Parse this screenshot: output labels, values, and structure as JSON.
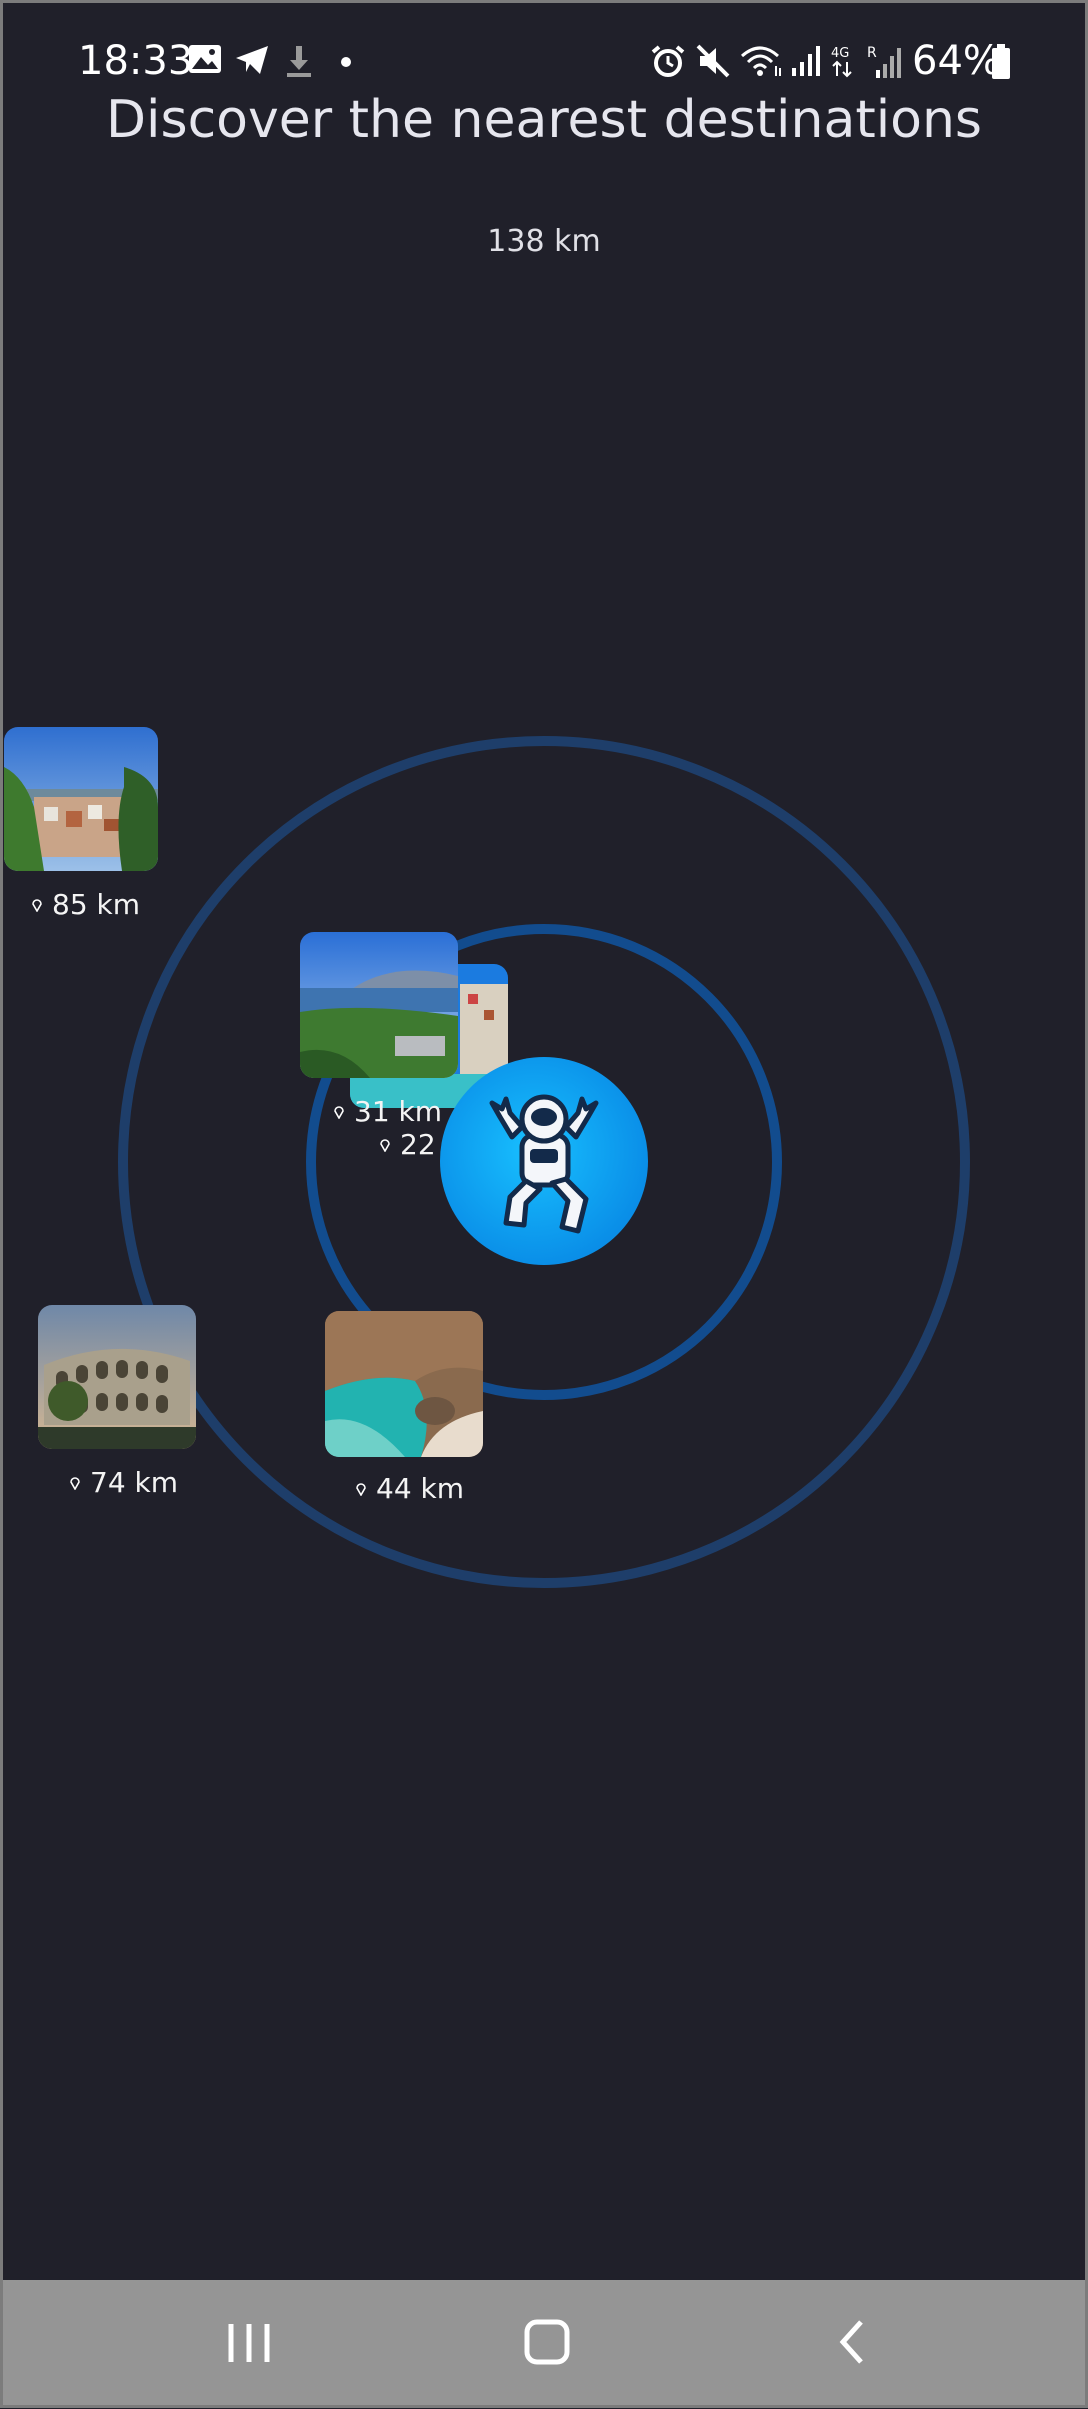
{
  "status_bar": {
    "time": "18:33",
    "battery_percent": "64%",
    "icons": [
      "image-icon",
      "telegram-icon",
      "download-icon",
      "dot-icon",
      "alarm-icon",
      "mute-icon",
      "wifi-icon",
      "signal-icon",
      "4g-icon",
      "signal-roaming-icon",
      "battery-icon"
    ]
  },
  "header": {
    "title": "Discover the nearest destinations"
  },
  "radar": {
    "outer_ring_label": "138 km",
    "ring_color": "#1e3e6a",
    "inner_ring_color": "#124c8e",
    "avatar_color": "#0fa8f5"
  },
  "destinations": [
    {
      "distance": "85 km",
      "image": "hillside-town-photo"
    },
    {
      "distance": "31 km",
      "image": "coastal-city-photo"
    },
    {
      "distance": "22 km",
      "image": "harbor-photo"
    },
    {
      "distance": "74 km",
      "image": "amphitheatre-photo"
    },
    {
      "distance": "44 km",
      "image": "rocky-beach-photo"
    }
  ],
  "nav_bar": {
    "buttons": [
      "recent-apps-icon",
      "home-icon",
      "back-icon"
    ]
  }
}
